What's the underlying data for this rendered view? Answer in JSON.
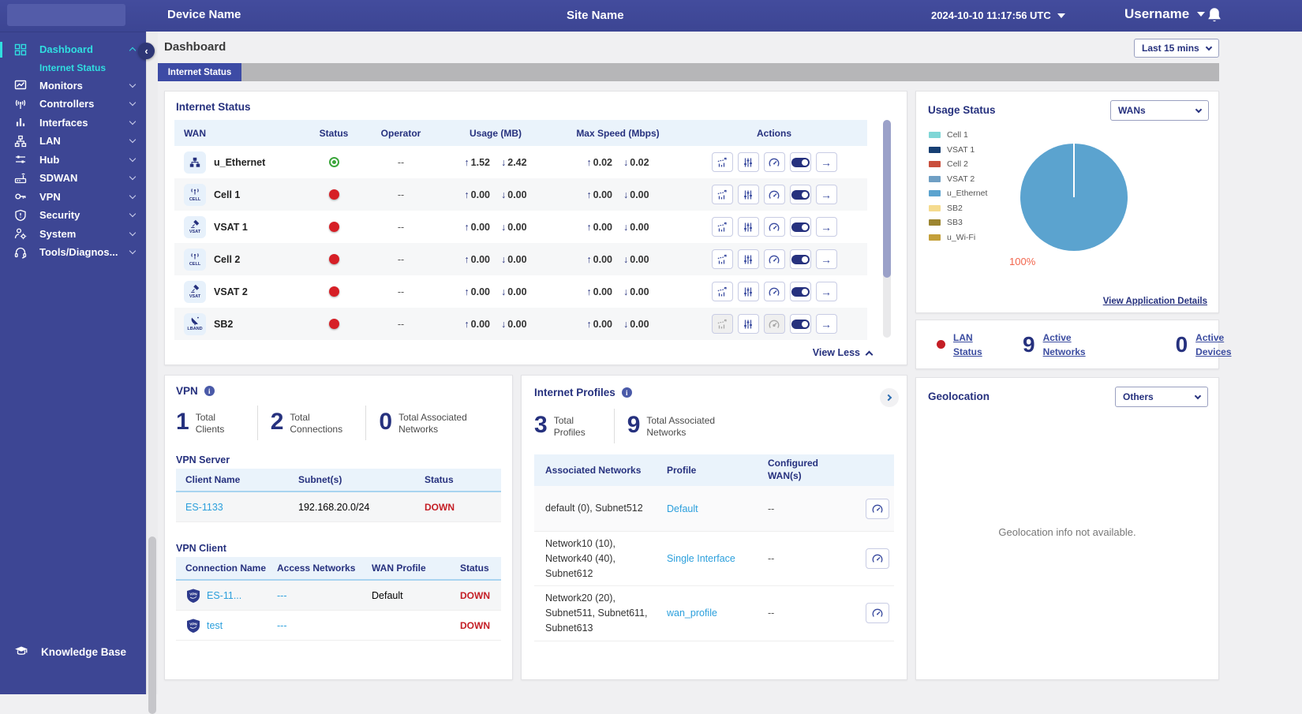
{
  "topbar": {
    "device_name": "Device Name",
    "site_name": "Site Name",
    "datetime": "2024-10-10 11:17:56 UTC",
    "username": "Username"
  },
  "sidebar": {
    "items": [
      {
        "label": "Dashboard",
        "icon": "dashboard-grid-icon"
      },
      {
        "label": "Internet Status",
        "icon": "none"
      },
      {
        "label": "Monitors",
        "icon": "monitors-icon"
      },
      {
        "label": "Controllers",
        "icon": "controllers-antenna-icon"
      },
      {
        "label": "Interfaces",
        "icon": "interfaces-bars-icon"
      },
      {
        "label": "LAN",
        "icon": "lan-topology-icon"
      },
      {
        "label": "Hub",
        "icon": "hub-sliders-icon"
      },
      {
        "label": "SDWAN",
        "icon": "sdwan-router-icon"
      },
      {
        "label": "VPN",
        "icon": "vpn-key-icon"
      },
      {
        "label": "Security",
        "icon": "security-shield-icon"
      },
      {
        "label": "System",
        "icon": "system-user-gear-icon"
      },
      {
        "label": "Tools/Diagnos...",
        "icon": "tools-headset-icon"
      }
    ],
    "knowledge_base": "Knowledge Base"
  },
  "page": {
    "title": "Dashboard",
    "time_filter": "Last 15 mins",
    "active_tab": "Internet Status"
  },
  "internet_status": {
    "title": "Internet Status",
    "columns": [
      "WAN",
      "Status",
      "Operator",
      "Usage (MB)",
      "Max Speed (Mbps)",
      "Actions"
    ],
    "rows": [
      {
        "name": "u_Ethernet",
        "icon_caption": "",
        "status": "up",
        "operator": "--",
        "usage_up": "1.52",
        "usage_down": "2.42",
        "speed_up": "0.02",
        "speed_down": "0.02"
      },
      {
        "name": "Cell 1",
        "icon_caption": "CELL",
        "status": "down",
        "operator": "--",
        "usage_up": "0.00",
        "usage_down": "0.00",
        "speed_up": "0.00",
        "speed_down": "0.00"
      },
      {
        "name": "VSAT 1",
        "icon_caption": "VSAT",
        "status": "down",
        "operator": "--",
        "usage_up": "0.00",
        "usage_down": "0.00",
        "speed_up": "0.00",
        "speed_down": "0.00"
      },
      {
        "name": "Cell 2",
        "icon_caption": "CELL",
        "status": "down",
        "operator": "--",
        "usage_up": "0.00",
        "usage_down": "0.00",
        "speed_up": "0.00",
        "speed_down": "0.00"
      },
      {
        "name": "VSAT 2",
        "icon_caption": "VSAT",
        "status": "down",
        "operator": "--",
        "usage_up": "0.00",
        "usage_down": "0.00",
        "speed_up": "0.00",
        "speed_down": "0.00"
      },
      {
        "name": "SB2",
        "icon_caption": "LBAND",
        "status": "down",
        "operator": "--",
        "usage_up": "0.00",
        "usage_down": "0.00",
        "speed_up": "0.00",
        "speed_down": "0.00"
      }
    ],
    "view_less": "View Less"
  },
  "usage_status": {
    "title": "Usage Status",
    "filter": "WANs",
    "legend": [
      {
        "label": "Cell 1",
        "color": "#7FD6D6"
      },
      {
        "label": "VSAT 1",
        "color": "#173F73"
      },
      {
        "label": "Cell 2",
        "color": "#C94F3D"
      },
      {
        "label": "VSAT 2",
        "color": "#6F9FC4"
      },
      {
        "label": "u_Ethernet",
        "color": "#5BA3CF"
      },
      {
        "label": "SB2",
        "color": "#F5DB8E"
      },
      {
        "label": "SB3",
        "color": "#9C8530"
      },
      {
        "label": "u_Wi-Fi",
        "color": "#C4A03A"
      }
    ],
    "percent_label": "100%",
    "details_link": "View Application Details"
  },
  "chart_data": {
    "type": "pie",
    "title": "Usage Status",
    "categories": [
      "Cell 1",
      "VSAT 1",
      "Cell 2",
      "VSAT 2",
      "u_Ethernet",
      "SB2",
      "SB3",
      "u_Wi-Fi"
    ],
    "values": [
      0,
      0,
      0,
      0,
      100,
      0,
      0,
      0
    ],
    "colors": [
      "#7FD6D6",
      "#173F73",
      "#C94F3D",
      "#6F9FC4",
      "#5BA3CF",
      "#F5DB8E",
      "#9C8530",
      "#C4A03A"
    ],
    "annotations": [
      "100%"
    ],
    "legend_position": "left"
  },
  "lan_summary": {
    "lan_status_label": "LAN Status",
    "active_networks_count": "9",
    "active_networks_label": "Active Networks",
    "active_devices_count": "0",
    "active_devices_label": "Active Devices"
  },
  "vpn": {
    "title": "VPN",
    "stats": [
      {
        "value": "1",
        "label": "Total Clients"
      },
      {
        "value": "2",
        "label": "Total Connections"
      },
      {
        "value": "0",
        "label": "Total Associated Networks"
      }
    ],
    "server": {
      "heading": "VPN Server",
      "columns": [
        "Client Name",
        "Subnet(s)",
        "Status"
      ],
      "rows": [
        {
          "client_name": "ES-1133",
          "subnets": "192.168.20.0/24",
          "status": "DOWN"
        }
      ]
    },
    "client": {
      "heading": "VPN Client",
      "columns": [
        "Connection Name",
        "Access Networks",
        "WAN Profile",
        "Status"
      ],
      "rows": [
        {
          "connection_name": "ES-11...",
          "access_networks": "---",
          "wan_profile": "Default",
          "status": "DOWN"
        },
        {
          "connection_name": "test",
          "access_networks": "---",
          "wan_profile": "",
          "status": "DOWN"
        }
      ]
    }
  },
  "internet_profiles": {
    "title": "Internet Profiles",
    "stats": [
      {
        "value": "3",
        "label": "Total Profiles"
      },
      {
        "value": "9",
        "label": "Total Associated Networks"
      }
    ],
    "columns": [
      "Associated Networks",
      "Profile",
      "Configured WAN(s)"
    ],
    "rows": [
      {
        "networks": "default (0), Subnet512",
        "profile": "Default",
        "configured": "--"
      },
      {
        "networks": "Network10 (10), Network40 (40), Subnet612",
        "profile": "Single Interface",
        "configured": "--"
      },
      {
        "networks": "Network20 (20), Subnet511, Subnet611, Subnet613",
        "profile": "wan_profile",
        "configured": "--"
      }
    ]
  },
  "geolocation": {
    "title": "Geolocation",
    "filter": "Others",
    "empty_message": "Geolocation info not available."
  }
}
